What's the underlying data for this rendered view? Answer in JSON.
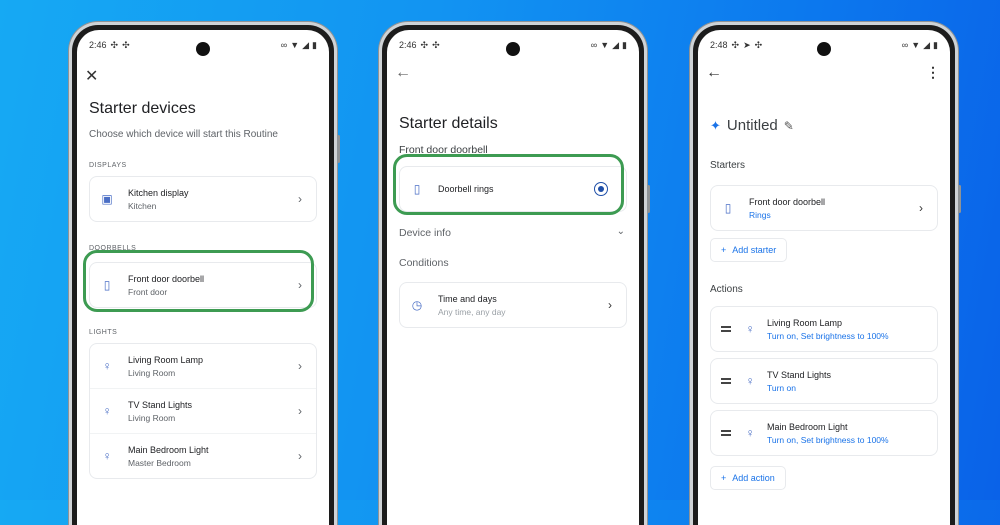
{
  "colors": {
    "accent": "#1a73e8",
    "highlight": "#3d9b52",
    "icon": "#4a6ec5"
  },
  "screens": [
    {
      "status": {
        "time": "2:46",
        "left_icons": [
          "slack-icon",
          "slack-icon"
        ],
        "right_icons": [
          "link-icon",
          "wifi-icon",
          "signal-icon",
          "battery-icon"
        ]
      },
      "top_icon": "✕",
      "title": "Starter devices",
      "subtitle": "Choose which device will start this Routine",
      "sections": [
        {
          "label": "DISPLAYS",
          "items": [
            {
              "name": "Kitchen display",
              "room": "Kitchen",
              "icon": "display-icon"
            }
          ]
        },
        {
          "label": "DOORBELLS",
          "items": [
            {
              "name": "Front door doorbell",
              "room": "Front door",
              "icon": "doorbell-icon",
              "highlighted": true
            }
          ]
        },
        {
          "label": "LIGHTS",
          "items": [
            {
              "name": "Living Room Lamp",
              "room": "Living Room",
              "icon": "lightbulb-icon"
            },
            {
              "name": "TV Stand Lights",
              "room": "Living Room",
              "icon": "lightbulb-icon"
            },
            {
              "name": "Main Bedroom Light",
              "room": "Master Bedroom",
              "icon": "lightbulb-icon"
            }
          ]
        }
      ]
    },
    {
      "status": {
        "time": "2:46"
      },
      "top_icon": "←",
      "title": "Starter details",
      "device": "Front door doorbell",
      "option": {
        "label": "Doorbell rings",
        "selected": true
      },
      "device_info": "Device info",
      "conditions": "Conditions",
      "condition_item": {
        "title": "Time and days",
        "subtitle": "Any time, any day"
      }
    },
    {
      "status": {
        "time": "2:48"
      },
      "top_icon": "←",
      "menu_icon": "⋮",
      "title": "Untitled",
      "starters_label": "Starters",
      "starter": {
        "name": "Front door doorbell",
        "detail": "Rings"
      },
      "add_starter": "Add starter",
      "actions_label": "Actions",
      "actions": [
        {
          "name": "Living Room Lamp",
          "detail": "Turn on, Set brightness to 100%"
        },
        {
          "name": "TV Stand Lights",
          "detail": "Turn on"
        },
        {
          "name": "Main Bedroom Light",
          "detail": "Turn on, Set brightness to 100%"
        }
      ],
      "add_action": "Add action"
    }
  ]
}
